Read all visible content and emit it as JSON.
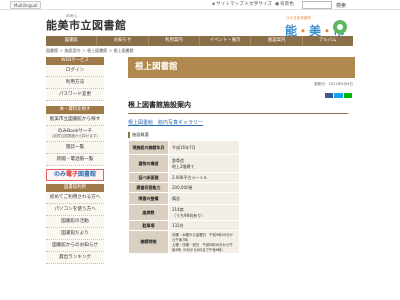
{
  "topbar": {
    "multilingual": "Multilingual",
    "font_size": "文字サイズ",
    "background_color": "背景色",
    "sitemap": "サイトマップ",
    "search_button": "検索"
  },
  "header": {
    "title_ruby": "のみし",
    "title": "能美市立図書館",
    "city_tagline": "ひかる未来都市",
    "city_name": [
      "能",
      "美",
      "市"
    ]
  },
  "gnav": [
    "図書館",
    "お知らせ",
    "利用案内",
    "イベント・展示",
    "施設案内",
    "アルバム"
  ],
  "breadcrumb": "図書館 ＞ 施設案内 ＞ 根上図書館 ＞ 根上図書館",
  "sidebar": {
    "web_service_head": "WEBサービス",
    "web_items": [
      "ログイン",
      "利用方法",
      "パスワード変更"
    ],
    "search_head": "本・資料を探す",
    "search_items": [
      {
        "label": "能美市立図書館から探す"
      },
      {
        "label": "のみBookサーチ",
        "sub": "(加賀山図書館から探せます)"
      },
      {
        "label": "雑誌一覧"
      },
      {
        "label": "新聞・電話帳一覧"
      }
    ],
    "banner_prefix": "のみ",
    "banner_mid": "電子",
    "banner_suffix": "図書館",
    "lib_head": "図書館利用",
    "lib_items": [
      "初めてご利用される方へ",
      "パソコンを使う方へ",
      "図書館の活動",
      "図書館だより",
      "図書館からのお知らせ",
      "貸出ランキング"
    ]
  },
  "main": {
    "page_title": "根上図書館",
    "updated": "更新日：2021年6月6日",
    "content_title": "根上図書館施設案内",
    "links": "根上図書館　館内写真ギャラリー",
    "section": "施設概要",
    "table": [
      {
        "label": "現施設の開館年月",
        "value": "平成16年7月"
      },
      {
        "label": "建物の構造",
        "value": "鉄骨造\n地上2階建て"
      },
      {
        "label": "延べ床面積",
        "value": "2,008平方メートル"
      },
      {
        "label": "蔵書収容能力",
        "value": "200,000冊"
      },
      {
        "label": "障害の整備",
        "value": "備含"
      },
      {
        "label": "座席数",
        "value": "214席\n（うち98机有り）"
      },
      {
        "label": "駐車場",
        "value": "132台"
      },
      {
        "label": "開館時間",
        "value": "月曜・水曜から金曜日　午前9時30分から午後7時\n土曜・日曜・祝日　午前9時30分から午後5時（6月から8月まで午後6時）"
      }
    ]
  }
}
